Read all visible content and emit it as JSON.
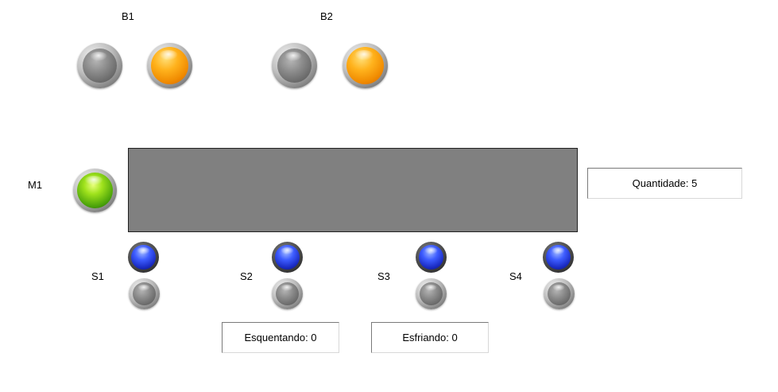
{
  "labels": {
    "b1": "B1",
    "b2": "B2",
    "m1": "M1",
    "s1": "S1",
    "s2": "S2",
    "s3": "S3",
    "s4": "S4"
  },
  "indicators": {
    "quantidade": "Quantidade: 5",
    "esquentando": "Esquentando: 0",
    "esfriando": "Esfriando: 0"
  },
  "lamps": {
    "b1_left": {
      "state": "off",
      "color": "#7a7a7a"
    },
    "b1_right": {
      "state": "on",
      "color": "#f5a000"
    },
    "b2_left": {
      "state": "off",
      "color": "#7a7a7a"
    },
    "b2_right": {
      "state": "on",
      "color": "#f5a000"
    },
    "m1": {
      "state": "on",
      "color": "#7ac81a"
    },
    "s1_top": {
      "state": "on",
      "color": "#2a3ae0"
    },
    "s1_bottom": {
      "state": "off",
      "color": "#7a7a7a"
    },
    "s2_top": {
      "state": "on",
      "color": "#2a3ae0"
    },
    "s2_bottom": {
      "state": "off",
      "color": "#7a7a7a"
    },
    "s3_top": {
      "state": "on",
      "color": "#2a3ae0"
    },
    "s3_bottom": {
      "state": "off",
      "color": "#7a7a7a"
    },
    "s4_top": {
      "state": "on",
      "color": "#2a3ae0"
    },
    "s4_bottom": {
      "state": "off",
      "color": "#7a7a7a"
    }
  },
  "colors": {
    "conveyor": "#808080",
    "background": "#ffffff"
  }
}
